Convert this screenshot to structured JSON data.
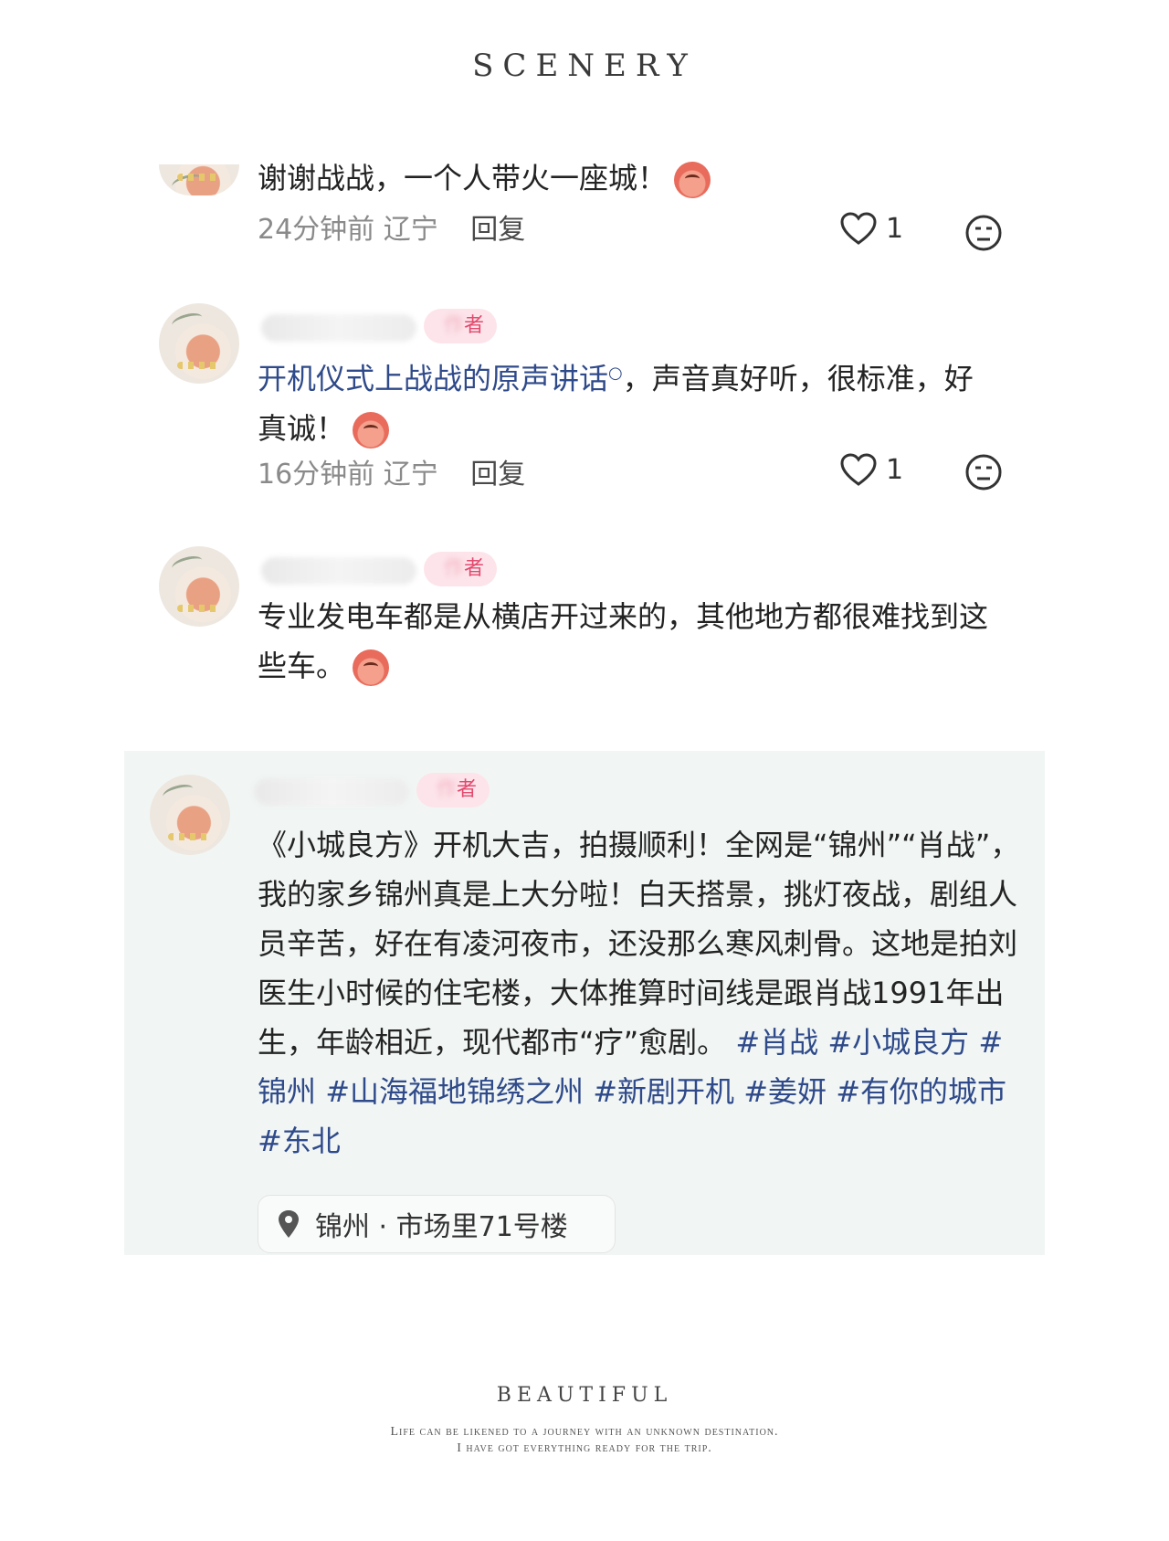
{
  "header": {
    "title": "SCENERY"
  },
  "comments": [
    {
      "text": "谢谢战战，一个人带火一座城！",
      "time": "24分钟前",
      "region": "辽宁",
      "reply_label": "回复",
      "likes": "1"
    },
    {
      "badge": "者",
      "link_text": "开机仪式上战战的原声讲话",
      "text_rest": "，声音真好听，很标准，好真诚！",
      "time": "16分钟前",
      "region": "辽宁",
      "reply_label": "回复",
      "likes": "1"
    },
    {
      "badge": "者",
      "text": "专业发电车都是从横店开过来的，其他地方都很难找到这些车。"
    },
    {
      "badge": "者",
      "text": "《小城良方》开机大吉，拍摄顺利！全网是“锦州”“肖战”，我的家乡锦州真是上大分啦！白天搭景，挑灯夜战，剧组人员辛苦，好在有凌河夜市，还没那么寒风刺骨。这地是拍刘医生小时候的住宅楼，大体推算时间线是跟肖战1991年出生，年龄相近，现代都市“疗”愈剧。",
      "hashtags": [
        "#肖战",
        "#小城良方",
        "#锦州",
        "#山海福地锦绣之州",
        "#新剧开机",
        "#姜妍",
        "#有你的城市",
        "#东北"
      ],
      "location": "锦州 · 市场里71号楼"
    }
  ],
  "footer": {
    "title": "BEAUTIFUL",
    "line1": "Life can be likened to a journey with an unknown destination.",
    "line2": "I have got everything ready for the trip."
  }
}
